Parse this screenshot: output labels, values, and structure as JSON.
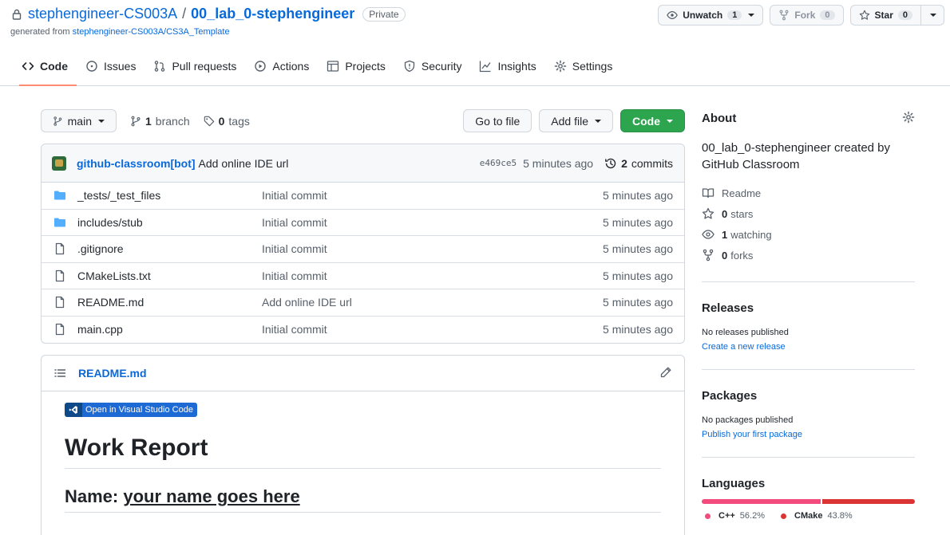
{
  "repo": {
    "owner": "stephengineer-CS003A",
    "separator": "/",
    "name": "00_lab_0-stephengineer",
    "visibility": "Private",
    "generated_prefix": "generated from",
    "template": "stephengineer-CS003A/CS3A_Template"
  },
  "actions": {
    "unwatch": "Unwatch",
    "watch_count": "1",
    "fork": "Fork",
    "fork_count": "0",
    "star": "Star",
    "star_count": "0"
  },
  "tabs": [
    {
      "label": "Code",
      "icon": "code-icon"
    },
    {
      "label": "Issues",
      "icon": "issue-icon"
    },
    {
      "label": "Pull requests",
      "icon": "pull-request-icon"
    },
    {
      "label": "Actions",
      "icon": "play-icon"
    },
    {
      "label": "Projects",
      "icon": "table-icon"
    },
    {
      "label": "Security",
      "icon": "shield-icon"
    },
    {
      "label": "Insights",
      "icon": "graph-icon"
    },
    {
      "label": "Settings",
      "icon": "gear-icon"
    }
  ],
  "toolbar": {
    "branch": "main",
    "branch_count": "1",
    "branch_label": "branch",
    "tag_count": "0",
    "tag_label": "tags",
    "go_to_file": "Go to file",
    "add_file": "Add file",
    "code": "Code"
  },
  "latest_commit": {
    "author": "github-classroom[bot]",
    "message": "Add online IDE url",
    "sha": "e469ce5",
    "time": "5 minutes ago",
    "commit_count": "2",
    "commit_label": "commits"
  },
  "files": [
    {
      "type": "folder",
      "name": "_tests/_test_files",
      "message": "Initial commit",
      "time": "5 minutes ago"
    },
    {
      "type": "folder",
      "name": "includes/stub",
      "message": "Initial commit",
      "time": "5 minutes ago"
    },
    {
      "type": "file",
      "name": ".gitignore",
      "message": "Initial commit",
      "time": "5 minutes ago"
    },
    {
      "type": "file",
      "name": "CMakeLists.txt",
      "message": "Initial commit",
      "time": "5 minutes ago"
    },
    {
      "type": "file",
      "name": "README.md",
      "message": "Add online IDE url",
      "time": "5 minutes ago"
    },
    {
      "type": "file",
      "name": "main.cpp",
      "message": "Initial commit",
      "time": "5 minutes ago"
    }
  ],
  "readme": {
    "filename": "README.md",
    "badge": "Open in Visual Studio Code",
    "heading": "Work Report",
    "name_label": "Name:",
    "name_value": "your name goes here"
  },
  "about": {
    "title": "About",
    "description": "00_lab_0-stephengineer created by GitHub Classroom",
    "readme": "Readme",
    "stars_count": "0",
    "stars_label": "stars",
    "watching_count": "1",
    "watching_label": "watching",
    "forks_count": "0",
    "forks_label": "forks"
  },
  "releases": {
    "title": "Releases",
    "empty": "No releases published",
    "link": "Create a new release"
  },
  "packages": {
    "title": "Packages",
    "empty": "No packages published",
    "link": "Publish your first package"
  },
  "languages": {
    "title": "Languages",
    "items": [
      {
        "name": "C++",
        "percent": "56.2%",
        "value": 56.2,
        "color": "#f34b7d"
      },
      {
        "name": "CMake",
        "percent": "43.8%",
        "value": 43.8,
        "color": "#DA3434"
      }
    ]
  }
}
